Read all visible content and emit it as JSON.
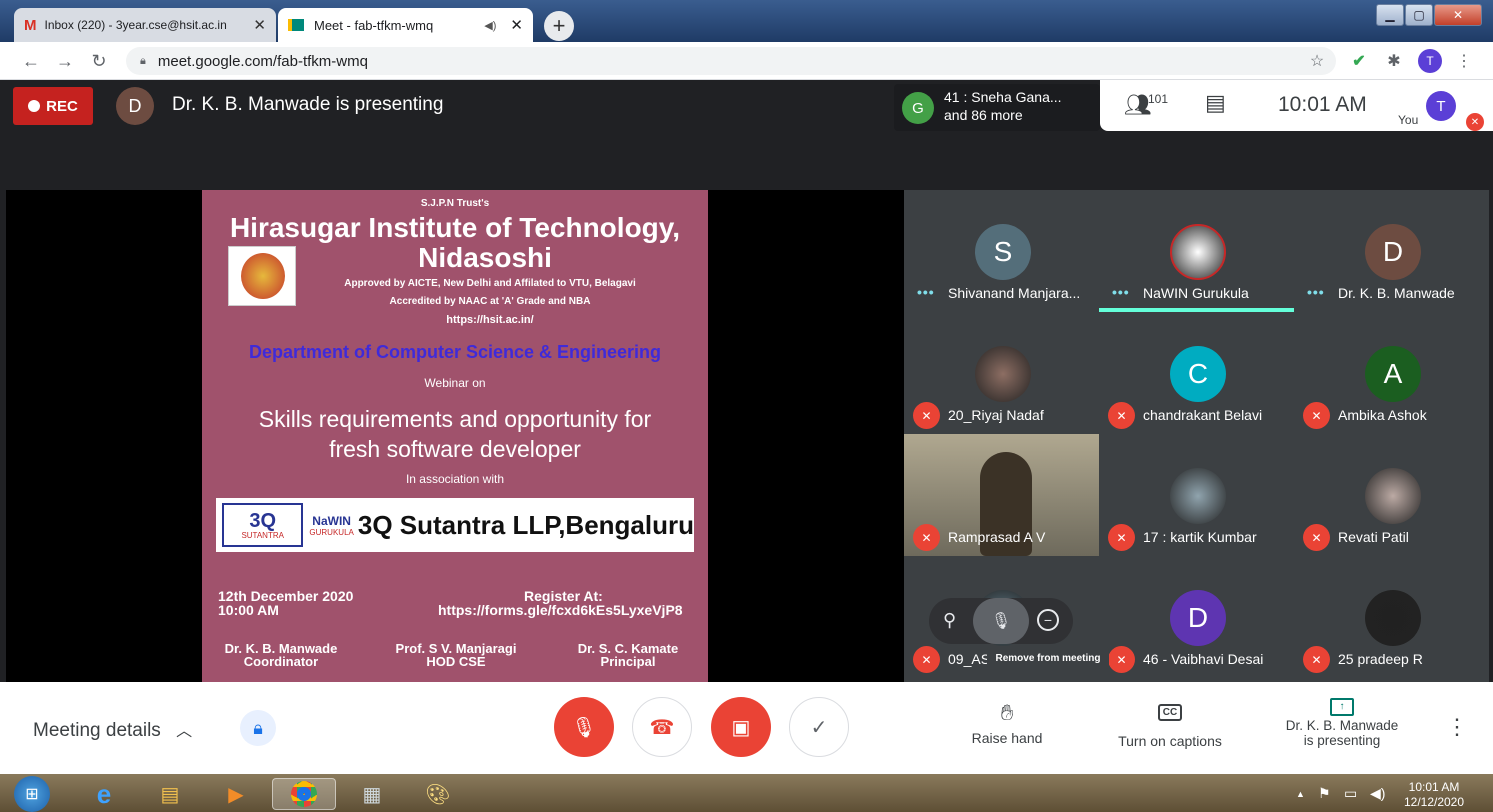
{
  "browser": {
    "tabs": [
      {
        "label": "Inbox (220) - 3year.cse@hsit.ac.in",
        "icon": "gmail-icon"
      },
      {
        "label": "Meet - fab-tfkm-wmq",
        "icon": "meet-icon"
      }
    ],
    "url": "meet.google.com/fab-tfkm-wmq",
    "profile_initial": "T"
  },
  "meet": {
    "rec_label": "REC",
    "presenter_initial": "D",
    "presenting_text": "Dr. K. B. Manwade is presenting",
    "chip_initial": "G",
    "chip_line1": "41 : Sneha Gana...",
    "chip_line2": "and 86 more",
    "people_count": "101",
    "time": "10:01 AM",
    "you_label": "You",
    "self_initial": "T"
  },
  "poster": {
    "trust": "S.J.P.N Trust's",
    "institute_line1": "Hirasugar Institute of Technology,",
    "institute_line2": "Nidasoshi",
    "approved": "Approved by AICTE, New Delhi and Affilated to VTU, Belagavi",
    "accredited": "Accredited by NAAC at 'A' Grade and NBA",
    "website": "https://hsit.ac.in/",
    "department": "Department of Computer Science & Engineering",
    "webinar_on": "Webinar on",
    "topic_line1": "Skills requirements and opportunity for",
    "topic_line2": "fresh software developer",
    "association": "In association with",
    "logo_3q": "3Q",
    "logo_sutantra": "SUTANTRA",
    "logo_nawin": "NaWIN",
    "logo_gurukula": "GURUKULA",
    "sponsor": "3Q Sutantra LLP,Bengaluru",
    "date": "12th December 2020",
    "time": "10:00 AM",
    "register_label": "Register At:",
    "register_url": "https://forms.gle/fcxd6kEs5LyxeVjP8",
    "people": [
      {
        "name": "Dr. K. B. Manwade",
        "role": "Coordinator"
      },
      {
        "name": "Prof. S V. Manjaragi",
        "role": "HOD CSE"
      },
      {
        "name": "Dr. S. C. Kamate",
        "role": "Principal"
      }
    ]
  },
  "participants": [
    {
      "name": "Shivanand Manjara...",
      "initial": "S",
      "color": "#546e7a",
      "state": "more"
    },
    {
      "name": "NaWIN Gurukula",
      "initial": "",
      "color": "#ffffff",
      "state": "more"
    },
    {
      "name": "Dr. K. B. Manwade",
      "initial": "D",
      "color": "#6d4c41",
      "state": "more"
    },
    {
      "name": "20_Riyaj Nadaf",
      "initial": "",
      "color": "#8d6e63",
      "state": "muted"
    },
    {
      "name": "chandrakant Belavi",
      "initial": "C",
      "color": "#00acc1",
      "state": "muted"
    },
    {
      "name": "Ambika Ashok",
      "initial": "A",
      "color": "#1b5e20",
      "state": "muted"
    },
    {
      "name": "Ramprasad A V",
      "initial": "",
      "color": "#7d7a6e",
      "state": "muted"
    },
    {
      "name": "17 : kartik Kumbar",
      "initial": "",
      "color": "#90a4ae",
      "state": "muted"
    },
    {
      "name": "Revati Patil",
      "initial": "",
      "color": "#bcaaa4",
      "state": "muted"
    },
    {
      "name": "09_AS",
      "initial": "",
      "color": "#607d8b",
      "state": "muted"
    },
    {
      "name": "46 - Vaibhavi Desai",
      "initial": "D",
      "color": "#5e35b1",
      "state": "muted"
    },
    {
      "name": "25 pradeep R",
      "initial": "",
      "color": "#212121",
      "state": "muted"
    }
  ],
  "tooltip": "Remove from meeting",
  "controls": {
    "meeting_details": "Meeting details",
    "raise_hand": "Raise hand",
    "captions": "Turn on captions",
    "presenting_line1": "Dr. K. B. Manwade",
    "presenting_line2": "is presenting"
  },
  "taskbar": {
    "time": "10:01 AM",
    "date": "12/12/2020"
  }
}
